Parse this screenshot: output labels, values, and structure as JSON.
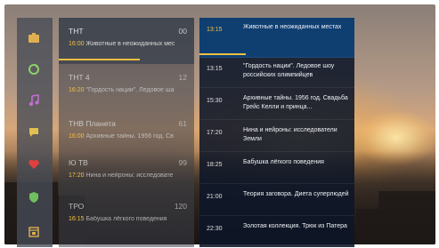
{
  "sidebar": {
    "items": [
      {
        "icon": "tv-icon",
        "color": "#e0b050",
        "active": true
      },
      {
        "icon": "refresh-icon",
        "color": "#8fd06a",
        "active": false
      },
      {
        "icon": "music-icon",
        "color": "#c070d0",
        "active": false
      },
      {
        "icon": "chat-icon",
        "color": "#e0c050",
        "active": false
      },
      {
        "icon": "heart-icon",
        "color": "#e04040",
        "active": false
      },
      {
        "icon": "shield-icon",
        "color": "#70c060",
        "active": false
      },
      {
        "icon": "calendar-icon",
        "color": "#e0b050",
        "active": false
      }
    ]
  },
  "channels": [
    {
      "name": "ТНТ",
      "number": "00",
      "time": "16:00",
      "title": "Животные в неожиданных мес",
      "progress": 0.6,
      "active": true
    },
    {
      "name": "ТНТ 4",
      "number": "12",
      "time": "16:20",
      "title": "\"Гордость нации\". Ледовое ша",
      "progress": null,
      "active": false
    },
    {
      "name": "ТНВ Планета",
      "number": "61",
      "time": "16:00",
      "title": "Архивные тайны. 1956 год. Св",
      "progress": null,
      "active": false
    },
    {
      "name": "Ю ТВ",
      "number": "99",
      "time": "17:20",
      "title": "Нина и нейроны: исследовате",
      "progress": null,
      "active": false
    },
    {
      "name": "ТРО",
      "number": "120",
      "time": "16:15",
      "title": "Бабушка лёгкого поведения",
      "progress": null,
      "active": false
    }
  ],
  "schedule": [
    {
      "time": "13:15",
      "title": "Животные в неожиданных местах",
      "active": true,
      "progress": 0.3
    },
    {
      "time": "13:15",
      "title": "\"Гордость нации\". Ледовое шоу российских олимпийцев",
      "active": false,
      "progress": null
    },
    {
      "time": "15:30",
      "title": "Архивные тайны. 1956 год. Свадьба Грейс Келли и принца...",
      "active": false,
      "progress": null
    },
    {
      "time": "17:20",
      "title": "Нина и нейроны: исследователи Земли",
      "active": false,
      "progress": null
    },
    {
      "time": "18:25",
      "title": "Бабушка лёгкого поведения",
      "active": false,
      "progress": null
    },
    {
      "time": "21:00",
      "title": "Теория заговора. Диета суперлюдей",
      "active": false,
      "progress": null
    },
    {
      "time": "22:30",
      "title": "Золотая коллекция. Трюк из Патера",
      "active": false,
      "progress": null
    }
  ]
}
